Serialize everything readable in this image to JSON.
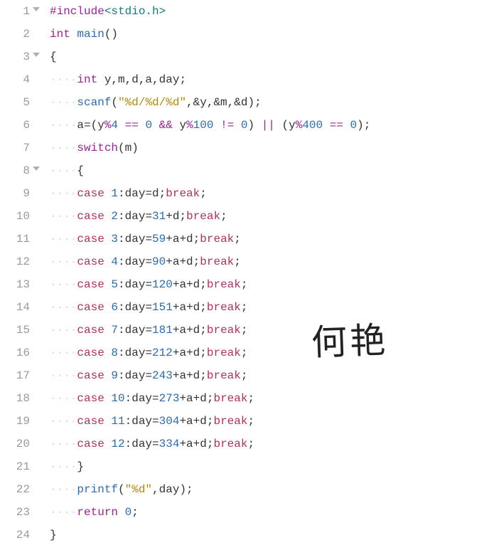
{
  "gutter": {
    "start": 1,
    "end": 24,
    "foldable": [
      1,
      3,
      8
    ]
  },
  "indentDots": "····",
  "code": {
    "l1": {
      "pp": "#include",
      "inc": "<stdio.h>"
    },
    "l2": {
      "type": "int",
      "fn": "main",
      "p": "()"
    },
    "l3": {
      "b": "{"
    },
    "l4": {
      "type": "int",
      "ids": " y,m,d,a,day;"
    },
    "l5": {
      "fn": "scanf",
      "open": "(",
      "str": "\"%d/%d/%d\"",
      "rest": ",&y,&m,&d);"
    },
    "l6": {
      "lhs": "a=(y",
      "op1": "%",
      "n4": "4",
      "eq1": " == ",
      "z1": "0",
      "and": " && ",
      "y2": "y",
      "op2": "%",
      "n100": "100",
      "ne": " != ",
      "z2": "0",
      "rparen": ") ",
      "or": "|| ",
      "open3": "(y",
      "op3": "%",
      "n400": "400",
      "eq3": " == ",
      "z3": "0",
      "end": ");"
    },
    "l7": {
      "kw": "switch",
      "rest": "(m)"
    },
    "l8": {
      "b": "{"
    },
    "l9": {
      "cs": "case ",
      "n": "1",
      "mid": ":day=d;",
      "br": "break",
      "e": ";"
    },
    "l10": {
      "cs": "case ",
      "n": "2",
      "mid": ":day=",
      "v": "31",
      "post": "+d;",
      "br": "break",
      "e": ";"
    },
    "l11": {
      "cs": "case ",
      "n": "3",
      "mid": ":day=",
      "v": "59",
      "post": "+a+d;",
      "br": "break",
      "e": ";"
    },
    "l12": {
      "cs": "case ",
      "n": "4",
      "mid": ":day=",
      "v": "90",
      "post": "+a+d;",
      "br": "break",
      "e": ";"
    },
    "l13": {
      "cs": "case ",
      "n": "5",
      "mid": ":day=",
      "v": "120",
      "post": "+a+d;",
      "br": "break",
      "e": ";"
    },
    "l14": {
      "cs": "case ",
      "n": "6",
      "mid": ":day=",
      "v": "151",
      "post": "+a+d;",
      "br": "break",
      "e": ";"
    },
    "l15": {
      "cs": "case ",
      "n": "7",
      "mid": ":day=",
      "v": "181",
      "post": "+a+d;",
      "br": "break",
      "e": ";"
    },
    "l16": {
      "cs": "case ",
      "n": "8",
      "mid": ":day=",
      "v": "212",
      "post": "+a+d;",
      "br": "break",
      "e": ";"
    },
    "l17": {
      "cs": "case ",
      "n": "9",
      "mid": ":day=",
      "v": "243",
      "post": "+a+d;",
      "br": "break",
      "e": ";"
    },
    "l18": {
      "cs": "case ",
      "n": "10",
      "mid": ":day=",
      "v": "273",
      "post": "+a+d;",
      "br": "break",
      "e": ";"
    },
    "l19": {
      "cs": "case ",
      "n": "11",
      "mid": ":day=",
      "v": "304",
      "post": "+a+d;",
      "br": "break",
      "e": ";"
    },
    "l20": {
      "cs": "case ",
      "n": "12",
      "mid": ":day=",
      "v": "334",
      "post": "+a+d;",
      "br": "break",
      "e": ";"
    },
    "l21": {
      "b": "}"
    },
    "l22": {
      "fn": "printf",
      "open": "(",
      "str": "\"%d\"",
      "rest": ",day);"
    },
    "l23": {
      "kw": "return",
      "sp": " ",
      "n": "0",
      "e": ";"
    },
    "l24": {
      "b": "}"
    }
  },
  "annotation": "何艳"
}
